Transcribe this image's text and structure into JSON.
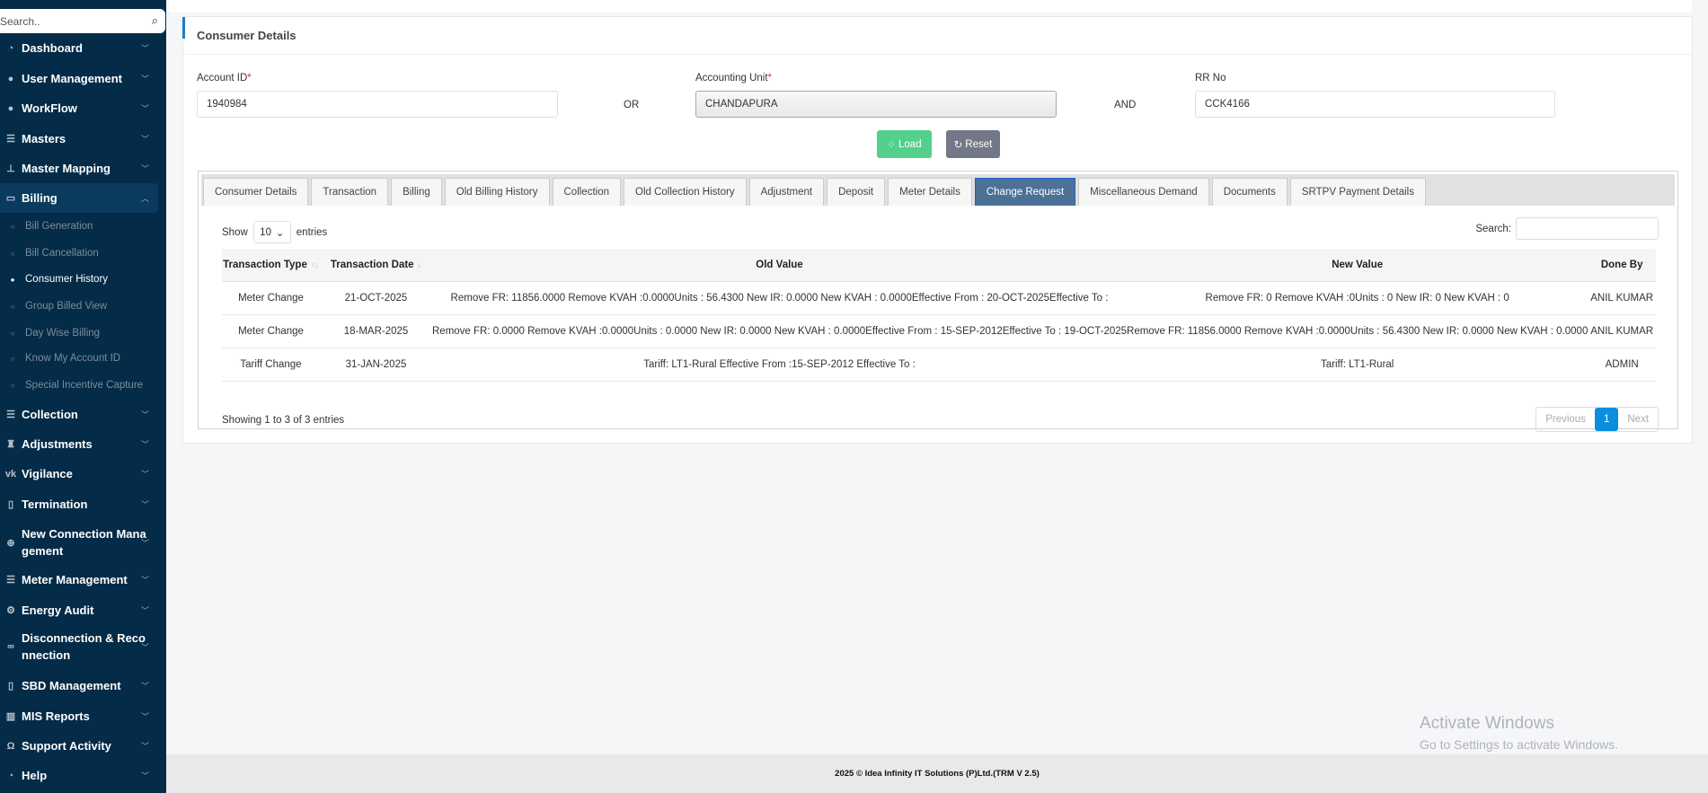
{
  "sidebar": {
    "search_placeholder": "Search..",
    "items": [
      {
        "label": "Dashboard",
        "icon": "dashboard-icon",
        "sym": "◔"
      },
      {
        "label": "User Management",
        "icon": "user-icon",
        "sym": "●"
      },
      {
        "label": "WorkFlow",
        "icon": "user-icon",
        "sym": "●"
      },
      {
        "label": "Masters",
        "icon": "list-icon",
        "sym": "☰"
      },
      {
        "label": "Master Mapping",
        "icon": "sitemap-icon",
        "sym": "⊥"
      },
      {
        "label": "Billing",
        "icon": "monitor-icon",
        "sym": "▭"
      }
    ],
    "billing_sub": [
      "Bill Generation",
      "Bill Cancellation",
      "Consumer History",
      "Group Billed View",
      "Day Wise Billing",
      "Know My Account ID",
      "Special Incentive Capture"
    ],
    "items2": [
      {
        "label": "Collection",
        "icon": "list-icon",
        "sym": "☰"
      },
      {
        "label": "Adjustments",
        "icon": "binoculars-icon",
        "sym": "♜"
      },
      {
        "label": "Vigilance",
        "icon": "vk-icon",
        "sym": "vk"
      },
      {
        "label": "Termination",
        "icon": "trash-icon",
        "sym": "▯"
      },
      {
        "label": "New Connection Management",
        "icon": "plus-circle-icon",
        "sym": "⊕"
      },
      {
        "label": "Meter Management",
        "icon": "list-icon",
        "sym": "☰"
      },
      {
        "label": "Energy Audit",
        "icon": "gears-icon",
        "sym": "⚙"
      },
      {
        "label": "Disconnection & Reconnection",
        "icon": "link-icon",
        "sym": "∞"
      },
      {
        "label": "SBD Management",
        "icon": "mobile-icon",
        "sym": "▯"
      },
      {
        "label": "MIS Reports",
        "icon": "bar-chart-icon",
        "sym": "▥"
      },
      {
        "label": "Support Activity",
        "icon": "headphones-icon",
        "sym": "Ω"
      },
      {
        "label": "Help",
        "icon": "dashboard-icon",
        "sym": "◔"
      }
    ]
  },
  "card": {
    "title": "Consumer Details"
  },
  "form": {
    "account_id_label": "Account ID",
    "account_id": "1940984",
    "or": "OR",
    "accounting_unit_label": "Accounting Unit",
    "accounting_unit": "CHANDAPURA",
    "and": "AND",
    "rr_label": "RR No",
    "rr": "CCK4166",
    "required": "*",
    "load": "Load",
    "reset": "Reset"
  },
  "tabs": [
    "Consumer Details",
    "Transaction",
    "Billing",
    "Old Billing History",
    "Collection",
    "Old Collection History",
    "Adjustment",
    "Deposit",
    "Meter Details",
    "Change Request",
    "Miscellaneous Demand",
    "Documents",
    "SRTPV Payment Details"
  ],
  "active_tab": "Change Request",
  "table": {
    "show": "Show",
    "entries_value": "10",
    "entries": "entries",
    "search_label": "Search:",
    "headers": [
      "Transaction Type",
      "Transaction Date",
      "Old Value",
      "New Value",
      "Done By"
    ],
    "rows": [
      [
        "Meter Change",
        "21-OCT-2025",
        "Remove FR: 11856.0000 Remove KVAH :0.0000Units : 56.4300 New IR: 0.0000 New KVAH : 0.0000Effective From : 20-OCT-2025Effective To :",
        "Remove FR: 0 Remove KVAH :0Units : 0 New IR: 0 New KVAH : 0",
        "ANIL KUMAR"
      ],
      [
        "Meter Change",
        "18-MAR-2025",
        "Remove FR: 0.0000 Remove KVAH :0.0000Units : 0.0000 New IR: 0.0000 New KVAH : 0.0000Effective From : 15-SEP-2012Effective To : 19-OCT-2025",
        "Remove FR: 11856.0000 Remove KVAH :0.0000Units : 56.4300 New IR: 0.0000 New KVAH : 0.0000",
        "ANIL KUMAR"
      ],
      [
        "Tariff Change",
        "31-JAN-2025",
        "Tariff: LT1-Rural Effective From :15-SEP-2012 Effective To :",
        "Tariff: LT1-Rural",
        "ADMIN"
      ]
    ],
    "info": "Showing 1 to 3 of 3 entries",
    "prev": "Previous",
    "page": "1",
    "next": "Next"
  },
  "footer": "2025 © Idea Infinity IT Solutions (P)Ltd.(TRM V 2.5)",
  "watermark": {
    "title": "Activate Windows",
    "sub": "Go to Settings to activate Windows."
  }
}
